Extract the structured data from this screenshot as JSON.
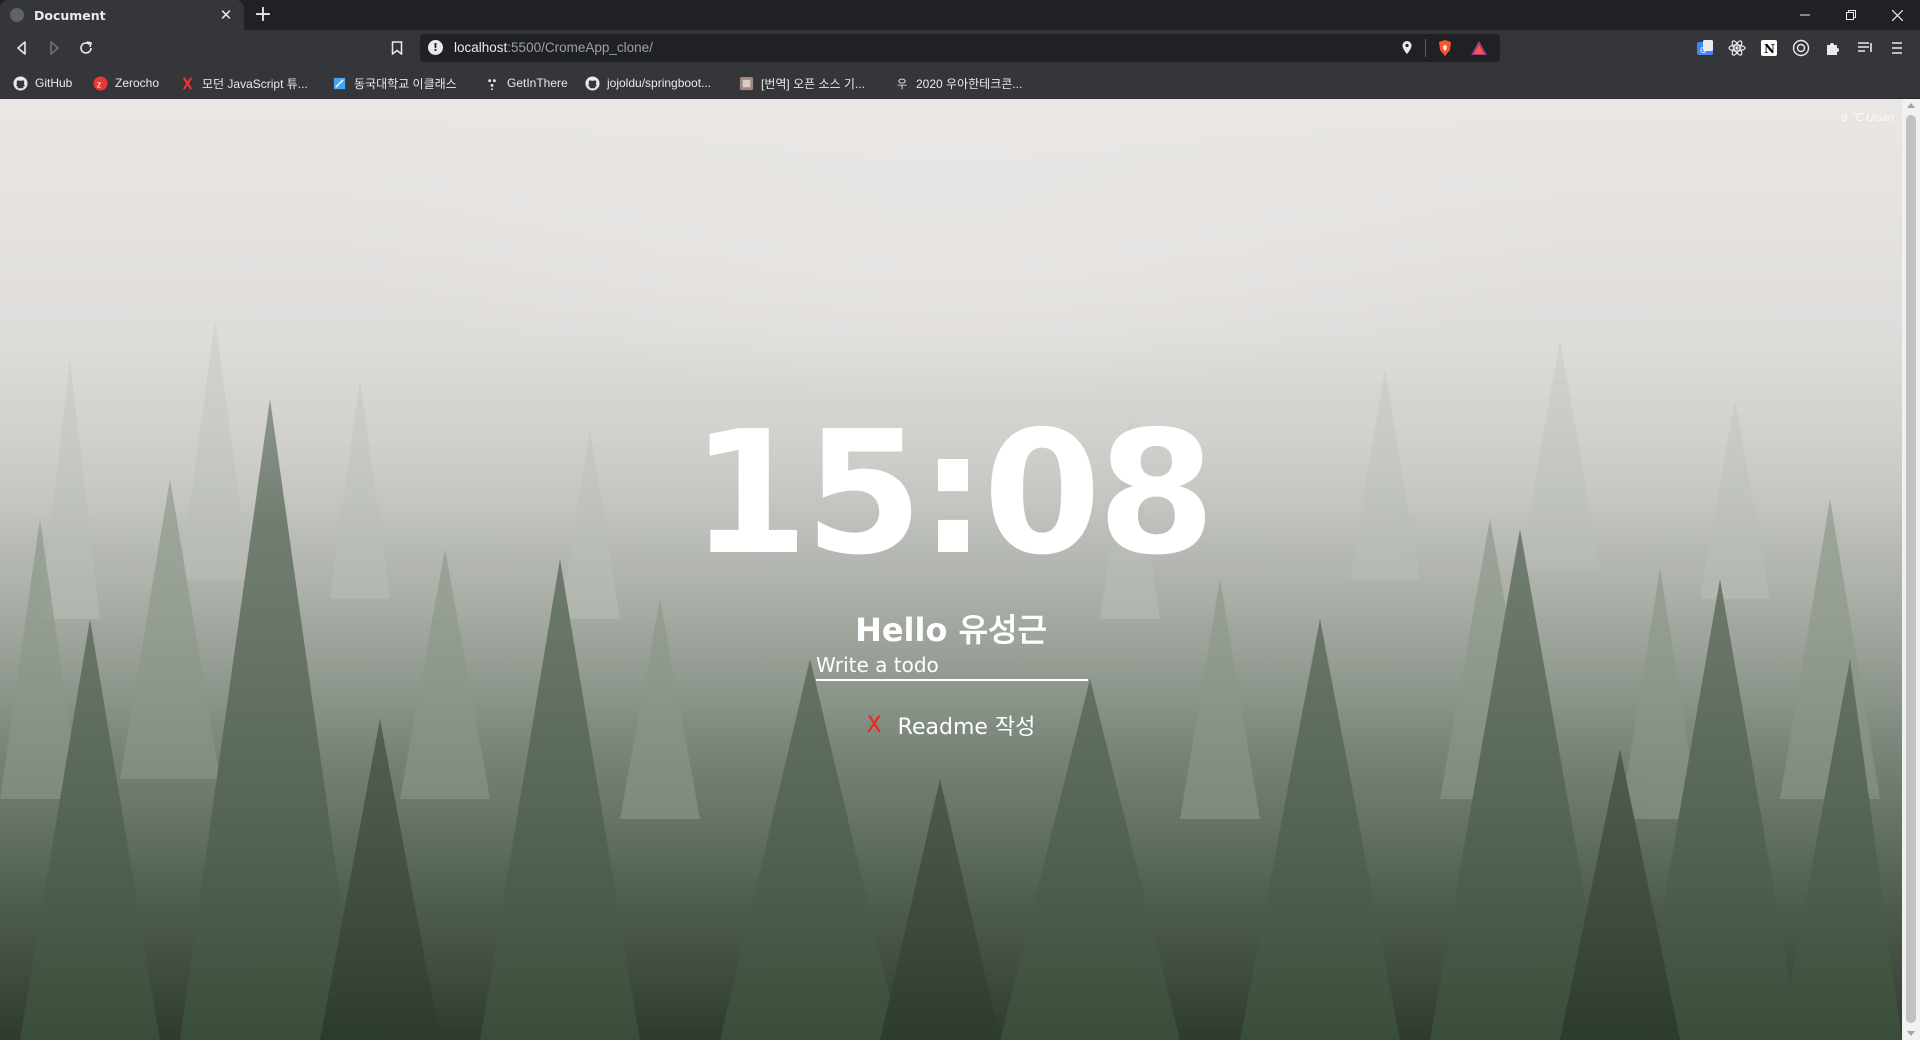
{
  "browser": {
    "tab_title": "Document",
    "tab_close": "✕",
    "new_tab": "+",
    "url_host": "localhost",
    "url_path": ":5500/CromeApp_clone/"
  },
  "bookmarks": [
    {
      "label": "GitHub",
      "icon": "github-icon"
    },
    {
      "label": "Zerocho",
      "icon": "zerocho-icon"
    },
    {
      "label": "모던 JavaScript 튜...",
      "icon": "javascript-icon"
    },
    {
      "label": "동국대학교 이클래스",
      "icon": "eclass-icon"
    },
    {
      "label": "GetInThere",
      "icon": "getinthere-icon"
    },
    {
      "label": "jojoldu/springboot...",
      "icon": "github-icon"
    },
    {
      "label": "[번역] 오픈 소스 기...",
      "icon": "article-icon"
    },
    {
      "label": "2020 우아한테크콘...",
      "icon": "woowa-icon"
    }
  ],
  "page": {
    "weather": "9 ℃ Ulsan",
    "clock": "15:08",
    "greeting": "Hello 유성근",
    "todo_placeholder": "Write a todo",
    "todos": [
      {
        "delete_label": "X",
        "text": "Readme 작성"
      }
    ]
  },
  "colors": {
    "delete_red": "#ff1a1a",
    "toolbar": "#35363a",
    "tabstrip": "#202124"
  }
}
